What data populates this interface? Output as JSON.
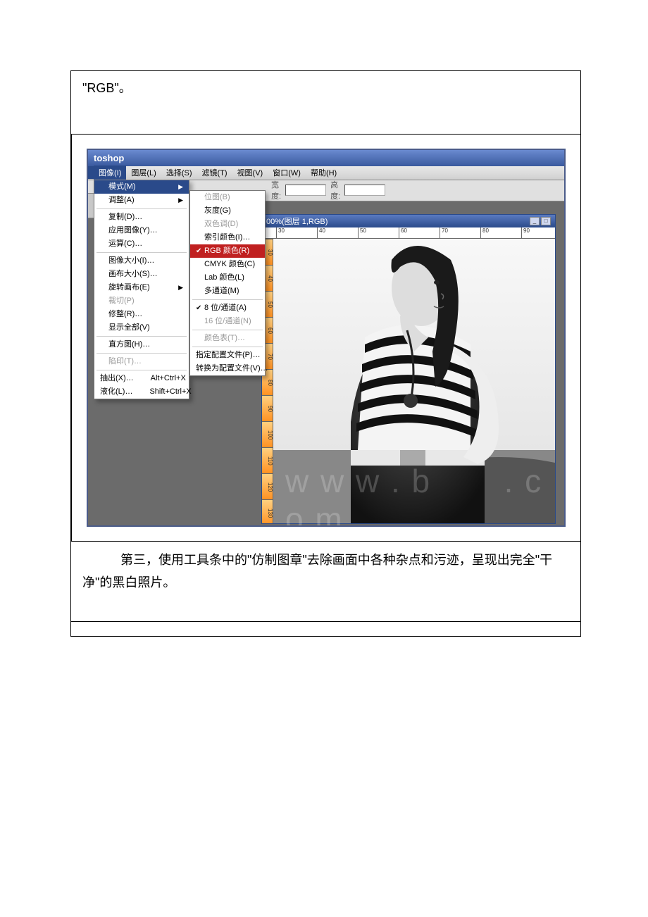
{
  "text_top": "\"RGB\"。",
  "text_mid": "　　　第三，使用工具条中的\"仿制图章\"去除画面中各种杂点和污迹，呈现出完全\"干净\"的黑白照片。",
  "app": {
    "title": "toshop",
    "menubar": [
      "图像(I)",
      "图层(L)",
      "选择(S)",
      "滤镜(T)",
      "视图(V)",
      "窗口(W)",
      "帮助(H)"
    ],
    "options": {
      "width_label": "宽度:",
      "height_label": "高度:"
    },
    "canvas": {
      "title": "00%(图层 1,RGB)",
      "ruler_h": [
        "30",
        "40",
        "50",
        "60",
        "70",
        "80",
        "90"
      ],
      "ruler_v": [
        "30",
        "40",
        "50",
        "60",
        "70",
        "80",
        "90",
        "100",
        "110",
        "120",
        "130"
      ]
    },
    "menu_main": [
      {
        "label": "模式(M)",
        "hl": true,
        "sub": true
      },
      {
        "label": "调整(A)",
        "sub": true
      },
      "sep",
      {
        "label": "复制(D)…"
      },
      {
        "label": "应用图像(Y)…"
      },
      {
        "label": "运算(C)…"
      },
      "sep",
      {
        "label": "图像大小(I)…"
      },
      {
        "label": "画布大小(S)…"
      },
      {
        "label": "旋转画布(E)",
        "sub": true
      },
      {
        "label": "裁切(P)",
        "disabled": true
      },
      {
        "label": "修整(R)…"
      },
      {
        "label": "显示全部(V)"
      },
      "sep",
      {
        "label": "直方图(H)…"
      },
      "sep",
      {
        "label": "陷印(T)…",
        "disabled": true
      },
      "sep",
      {
        "label": "抽出(X)…",
        "shortcut": "Alt+Ctrl+X"
      },
      {
        "label": "液化(L)…",
        "shortcut": "Shift+Ctrl+X"
      }
    ],
    "menu_sub": [
      {
        "label": "位图(B)",
        "disabled": true
      },
      {
        "label": "灰度(G)"
      },
      {
        "label": "双色调(D)",
        "disabled": true
      },
      {
        "label": "索引颜色(I)…"
      },
      {
        "label": "RGB 颜色(R)",
        "hl": true,
        "checked": true
      },
      {
        "label": "CMYK 颜色(C)"
      },
      {
        "label": "Lab 颜色(L)"
      },
      {
        "label": "多通道(M)"
      },
      "sep",
      {
        "label": "8 位/通道(A)",
        "checked": true
      },
      {
        "label": "16 位/通道(N)",
        "disabled": true
      },
      "sep",
      {
        "label": "颜色表(T)…",
        "disabled": true
      },
      "sep",
      {
        "label": "指定配置文件(P)…"
      },
      {
        "label": "转换为配置文件(V)…"
      }
    ]
  }
}
